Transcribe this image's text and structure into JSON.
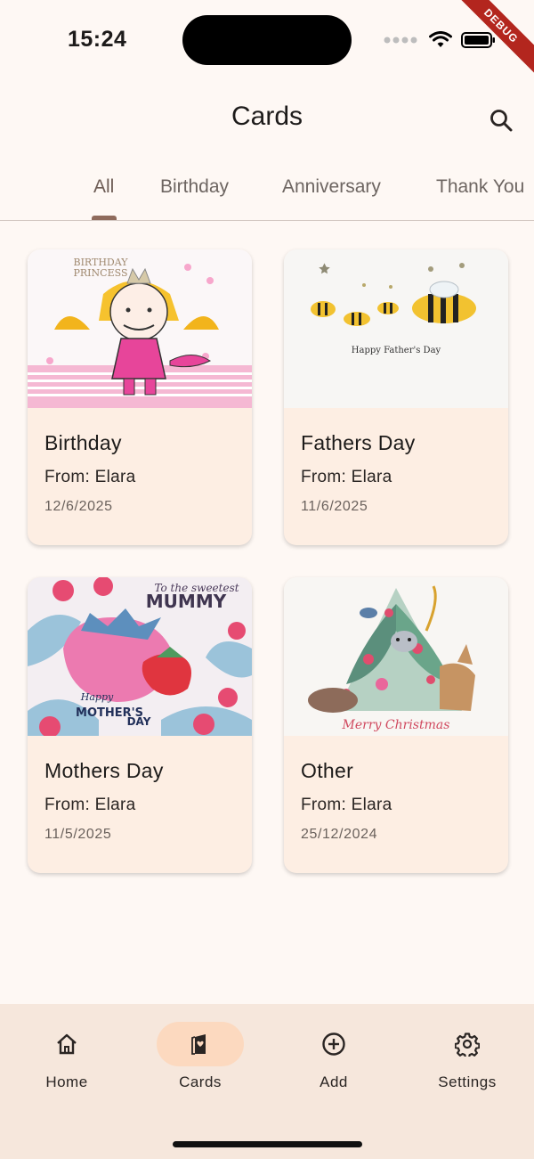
{
  "status_bar": {
    "time": "15:24",
    "debug_label": "DEBUG"
  },
  "app_bar": {
    "title": "Cards",
    "search_icon": "search-icon"
  },
  "tabs": [
    {
      "label": "All",
      "active": true
    },
    {
      "label": "Birthday",
      "active": false
    },
    {
      "label": "Anniversary",
      "active": false
    },
    {
      "label": "Thank You",
      "active": false
    }
  ],
  "cards": [
    {
      "title": "Birthday",
      "from": "From: Elara",
      "date": "12/6/2025",
      "image_text": [
        "BIRTHDAY",
        "PRINCESS"
      ]
    },
    {
      "title": "Fathers Day",
      "from": "From: Elara",
      "date": "11/6/2025",
      "image_text": [
        "Happy Father's Day"
      ]
    },
    {
      "title": "Mothers Day",
      "from": "From: Elara",
      "date": "11/5/2025",
      "image_text": [
        "To the sweetest",
        "MUMMY",
        "Happy",
        "MOTHER'S",
        "DAY"
      ]
    },
    {
      "title": "Other",
      "from": "From: Elara",
      "date": "25/12/2024",
      "image_text": [
        "Merry Christmas"
      ]
    }
  ],
  "bottom_nav": [
    {
      "label": "Home",
      "icon": "home-icon",
      "active": false
    },
    {
      "label": "Cards",
      "icon": "cards-icon",
      "active": true
    },
    {
      "label": "Add",
      "icon": "add-circle-icon",
      "active": false
    },
    {
      "label": "Settings",
      "icon": "gear-icon",
      "active": false
    }
  ],
  "colors": {
    "background": "#fef8f4",
    "card": "#fdeee3",
    "nav_background": "#f6e7dc",
    "nav_active_pill": "#fcd9bf",
    "tab_indicator": "#8f6b5c"
  }
}
